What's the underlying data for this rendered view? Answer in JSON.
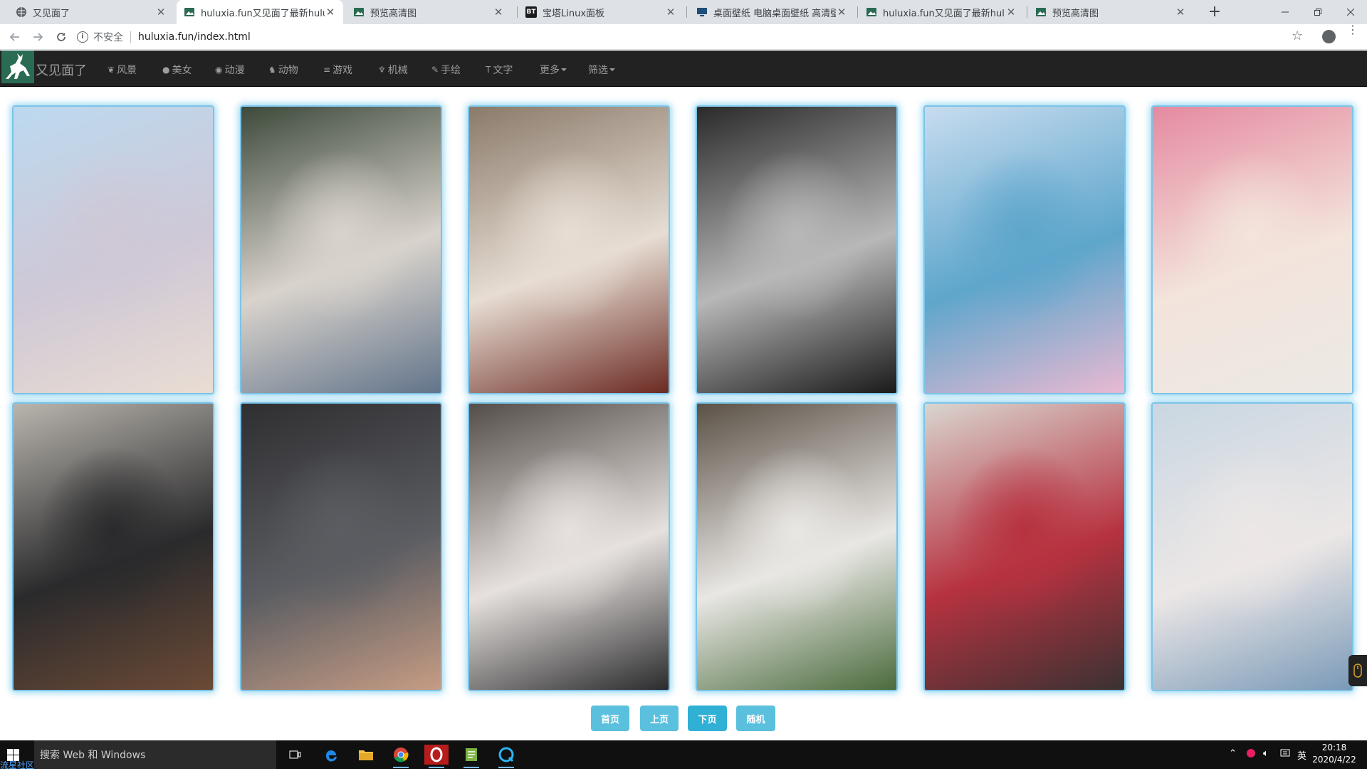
{
  "browser": {
    "tabs": [
      {
        "title": "又见面了",
        "icon": "globe-icon",
        "active": false
      },
      {
        "title": "huluxia.fun又见面了最新huluxia",
        "icon": "image-icon",
        "active": true
      },
      {
        "title": "预览高清图",
        "icon": "image-icon",
        "active": false
      },
      {
        "title": "宝塔Linux面板",
        "icon": "bt-icon",
        "active": false
      },
      {
        "title": "桌面壁纸 电脑桌面壁纸 高清壁纸",
        "icon": "monitor-icon",
        "active": false
      },
      {
        "title": "huluxia.fun又见面了最新huluxia",
        "icon": "image-icon",
        "active": false
      },
      {
        "title": "预览高清图",
        "icon": "image-icon",
        "active": false
      }
    ],
    "new_tab": "+",
    "address": {
      "security_label": "不安全",
      "url": "huluxia.fun/index.html"
    },
    "bt_badge": "BT"
  },
  "site": {
    "brand": "又见面了",
    "nav": [
      {
        "label": "风景",
        "icon": "leaf-icon",
        "glyph": "❦"
      },
      {
        "label": "美女",
        "icon": "apple-icon",
        "glyph": ""
      },
      {
        "label": "动漫",
        "icon": "eye-icon",
        "glyph": "◉"
      },
      {
        "label": "动物",
        "icon": "bird-icon",
        "glyph": "♞"
      },
      {
        "label": "游戏",
        "icon": "stack-icon",
        "glyph": "≡"
      },
      {
        "label": "机械",
        "icon": "tree-icon",
        "glyph": "♆"
      },
      {
        "label": "手绘",
        "icon": "brush-icon",
        "glyph": "✎"
      },
      {
        "label": "文字",
        "icon": "text-icon",
        "glyph": "T"
      }
    ],
    "more": "更多",
    "filter": "筛选"
  },
  "gallery": {
    "images": [
      {
        "name": "photo-beach-swimsuit",
        "colors": [
          "#bcd9ef",
          "#cfc8d6",
          "#e9ddd3"
        ]
      },
      {
        "name": "photo-sunglasses-denim",
        "colors": [
          "#3d4a3b",
          "#d9d3cc",
          "#62748a"
        ]
      },
      {
        "name": "photo-lace-dress-chair",
        "colors": [
          "#8a7a6a",
          "#e7ddd3",
          "#6b2a22"
        ]
      },
      {
        "name": "photo-black-white-portrait",
        "colors": [
          "#2a2a2a",
          "#b8b8b8",
          "#1a1a1a"
        ]
      },
      {
        "name": "photo-stadium-steps",
        "colors": [
          "#c7dcef",
          "#5ea6cc",
          "#e9b9d2"
        ]
      },
      {
        "name": "photo-pink-rose",
        "colors": [
          "#e58aa0",
          "#f3e4dc",
          "#ece9e4"
        ]
      },
      {
        "name": "photo-black-dress-bench",
        "colors": [
          "#b9b5ae",
          "#2a2a2c",
          "#6b4a36"
        ]
      },
      {
        "name": "photo-grey-dress",
        "colors": [
          "#2f2e31",
          "#5b5d62",
          "#c69c84"
        ]
      },
      {
        "name": "photo-bodysuit-boots",
        "colors": [
          "#544d4a",
          "#e6e1de",
          "#2b2b2d"
        ]
      },
      {
        "name": "photo-white-shirt-wall",
        "colors": [
          "#5b5146",
          "#e9e7e4",
          "#4b6b3d"
        ]
      },
      {
        "name": "photo-red-sweater-door",
        "colors": [
          "#d9d6d0",
          "#b73240",
          "#3a3232"
        ]
      },
      {
        "name": "photo-knit-top-shorts",
        "colors": [
          "#c9d7e2",
          "#ece7e6",
          "#7a9ab8"
        ]
      }
    ]
  },
  "pager": {
    "first": "首页",
    "prev": "上页",
    "next": "下页",
    "random": "随机"
  },
  "taskbar": {
    "search_placeholder": "搜索 Web 和 Windows",
    "community": "流星社区",
    "apps": [
      "task-view-icon",
      "edge-icon",
      "file-explorer-icon",
      "chrome-icon",
      "opera-icon",
      "notepad-icon",
      "qq-icon"
    ],
    "ime": "英",
    "time": "20:18",
    "date": "2020/4/22"
  }
}
